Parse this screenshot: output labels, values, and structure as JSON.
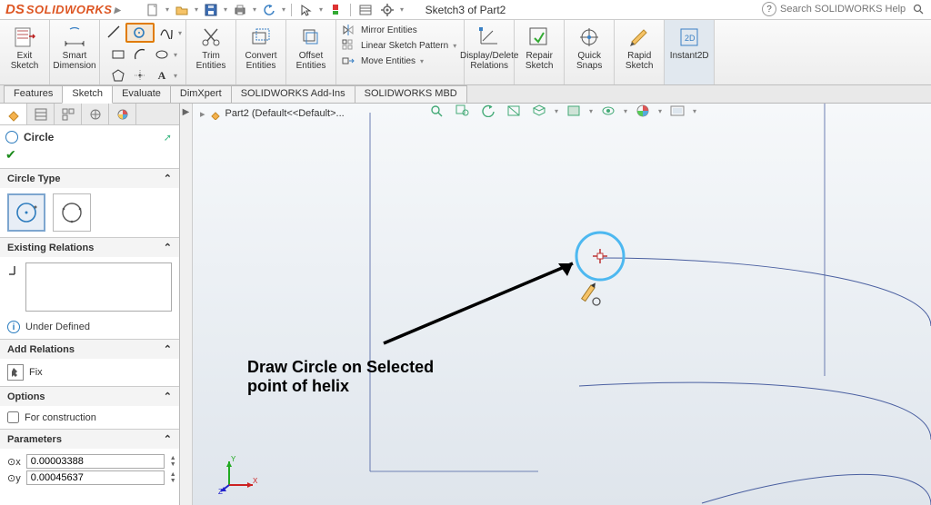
{
  "app": {
    "brand_ds": "DS",
    "brand_name": "SOLIDWORKS",
    "document_title": "Sketch3 of Part2"
  },
  "search": {
    "placeholder": "Search SOLIDWORKS Help"
  },
  "ribbon": {
    "exit_sketch": "Exit Sketch",
    "smart_dim": "Smart Dimension",
    "trim": "Trim Entities",
    "convert": "Convert Entities",
    "offset": "Offset Entities",
    "mirror": "Mirror Entities",
    "pattern": "Linear Sketch Pattern",
    "move": "Move Entities",
    "disp_rel": "Display/Delete Relations",
    "repair": "Repair Sketch",
    "quick_snaps": "Quick Snaps",
    "rapid": "Rapid Sketch",
    "instant2d": "Instant2D"
  },
  "cmd_tabs": [
    "Features",
    "Sketch",
    "Evaluate",
    "DimXpert",
    "SOLIDWORKS Add-Ins",
    "SOLIDWORKS MBD"
  ],
  "ftree": {
    "root": "Part2  (Default<<Default>..."
  },
  "pm": {
    "title": "Circle",
    "circle_type": "Circle Type",
    "existing_relations": "Existing Relations",
    "under_defined": "Under Defined",
    "add_relations": "Add Relations",
    "fix": "Fix",
    "options": "Options",
    "for_construction": "For construction",
    "parameters": "Parameters",
    "p1": "0.00003388",
    "p2": "0.00045637"
  },
  "annotation": {
    "line1": "Draw Circle on Selected",
    "line2": "point of helix"
  }
}
